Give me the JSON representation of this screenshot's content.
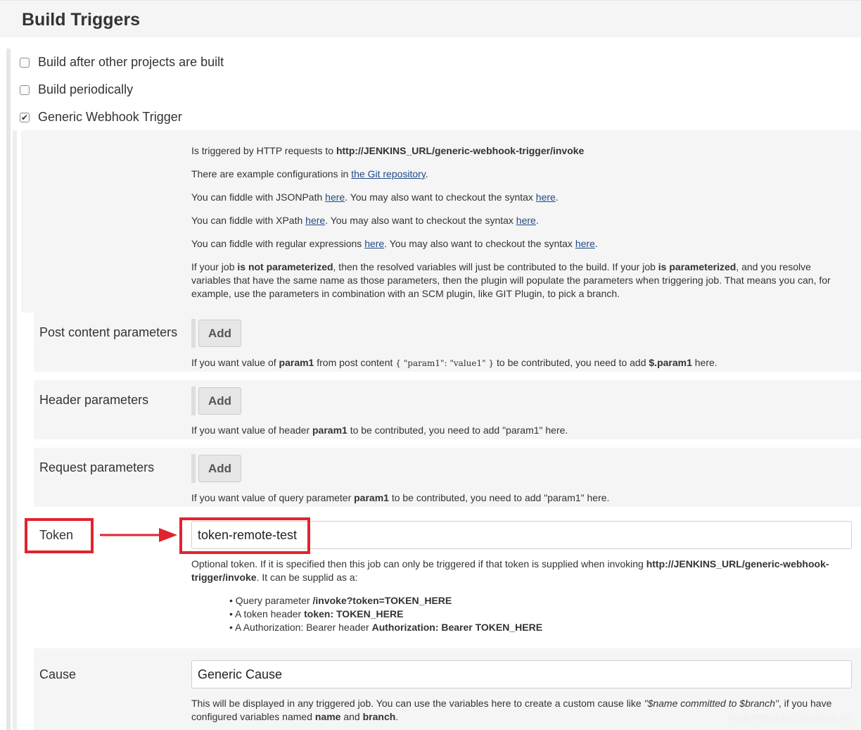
{
  "section_title": "Build Triggers",
  "triggers": [
    {
      "label": "Build after other projects are built",
      "checked": false
    },
    {
      "label": "Build periodically",
      "checked": false
    },
    {
      "label": "Generic Webhook Trigger",
      "checked": true
    }
  ],
  "help": {
    "line1_prefix": "Is triggered by HTTP requests to ",
    "line1_url": "http://JENKINS_URL/generic-webhook-trigger/invoke",
    "line2_prefix": "There are example configurations in ",
    "line2_link": "the Git repository",
    "line2_suffix": ".",
    "jsonpath_prefix": "You can fiddle with JSONPath ",
    "xpath_prefix": "You can fiddle with XPath ",
    "regex_prefix": "You can fiddle with regular expressions ",
    "here": "here",
    "syntax_mid": ". You may also want to checkout the syntax ",
    "period": ".",
    "p_a": "If your job ",
    "p_b": "is not parameterized",
    "p_c": ", then the resolved variables will just be contributed to the build. If your job ",
    "p_d": "is parameterized",
    "p_e": ", and you resolve variables that have the same name as those parameters, then the plugin will populate the parameters when triggering job. That means you can, for example, use the parameters in combination with an SCM plugin, like GIT Plugin, to pick a branch."
  },
  "add_label": "Add",
  "post_content": {
    "label": "Post content parameters",
    "help_a": "If you want value of ",
    "help_b": "param1",
    "help_c": " from post content ",
    "help_code": "{ \"param1\": \"value1\" }",
    "help_d": " to be contributed, you need to add ",
    "help_e": "$.param1",
    "help_f": " here."
  },
  "header_params": {
    "label": "Header parameters",
    "help_a": "If you want value of header ",
    "help_b": "param1",
    "help_c": " to be contributed, you need to add \"param1\" here."
  },
  "request_params": {
    "label": "Request parameters",
    "help_a": "If you want value of query parameter ",
    "help_b": "param1",
    "help_c": " to be contributed, you need to add \"param1\" here."
  },
  "token": {
    "label": "Token",
    "value": "token-remote-test",
    "help_a": "Optional token. If it is specified then this job can only be triggered if that token is supplied when invoking ",
    "help_b": "http://JENKINS_URL/generic-webhook-trigger/invoke",
    "help_c": ". It can be supplid as a:",
    "bullets": [
      {
        "text": "Query parameter ",
        "bold": "/invoke?token=TOKEN_HERE"
      },
      {
        "text": "A token header ",
        "bold": "token: TOKEN_HERE"
      },
      {
        "text": "A Authorization: Bearer header ",
        "bold": "Authorization: Bearer TOKEN_HERE"
      }
    ],
    "highlight_color": "#e0242f"
  },
  "cause": {
    "label": "Cause",
    "value": "Generic Cause",
    "help_a": "This will be displayed in any triggered job. You can use the variables here to create a custom cause like ",
    "help_b": "\"$name committed to $branch\"",
    "help_c": ", if you have configured variables named ",
    "help_d": "name",
    "help_e": " and ",
    "help_f": "branch",
    "help_g": "."
  },
  "watermark": "https://xinchen.blog.csdn.net"
}
